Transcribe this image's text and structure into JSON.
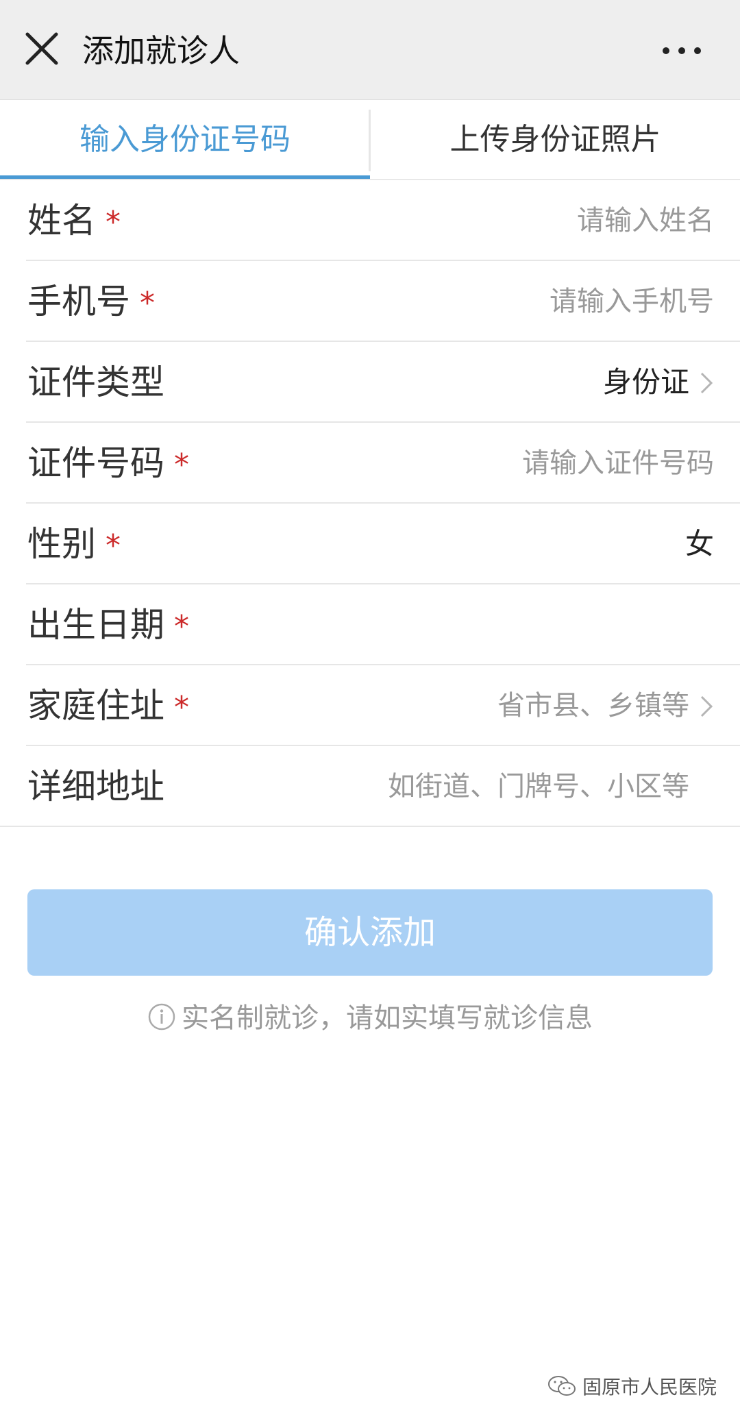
{
  "colors": {
    "accent": "#4a9ad4",
    "button_bg": "#a9d0f5",
    "required": "#cc2a2a"
  },
  "header": {
    "title": "添加就诊人",
    "close_icon": "close-icon",
    "more_icon": "more-horizontal-icon"
  },
  "tabs": [
    {
      "label": "输入身份证号码",
      "active": true
    },
    {
      "label": "上传身份证照片",
      "active": false
    }
  ],
  "form": {
    "required_mark": "*",
    "fields": [
      {
        "label": "姓名",
        "required": true,
        "placeholder": "请输入姓名"
      },
      {
        "label": "手机号",
        "required": true,
        "placeholder": "请输入手机号"
      },
      {
        "label": "证件类型",
        "required": false,
        "value": "身份证",
        "icon": "chevron-right-icon"
      },
      {
        "label": "证件号码",
        "required": true,
        "placeholder": "请输入证件号码"
      },
      {
        "label": "性别",
        "required": true,
        "value": "女"
      },
      {
        "label": "出生日期",
        "required": true
      },
      {
        "label": "家庭住址",
        "required": true,
        "placeholder": "省市县、乡镇等",
        "icon": "chevron-right-icon"
      },
      {
        "label": "详细地址",
        "required": false,
        "placeholder": "如街道、门牌号、小区等"
      }
    ]
  },
  "submit": {
    "label": "确认添加"
  },
  "notice": {
    "icon": "info-icon",
    "text": "实名制就诊，请如实填写就诊信息"
  },
  "watermark": {
    "icon": "wechat-icon",
    "text": "固原市人民医院"
  }
}
